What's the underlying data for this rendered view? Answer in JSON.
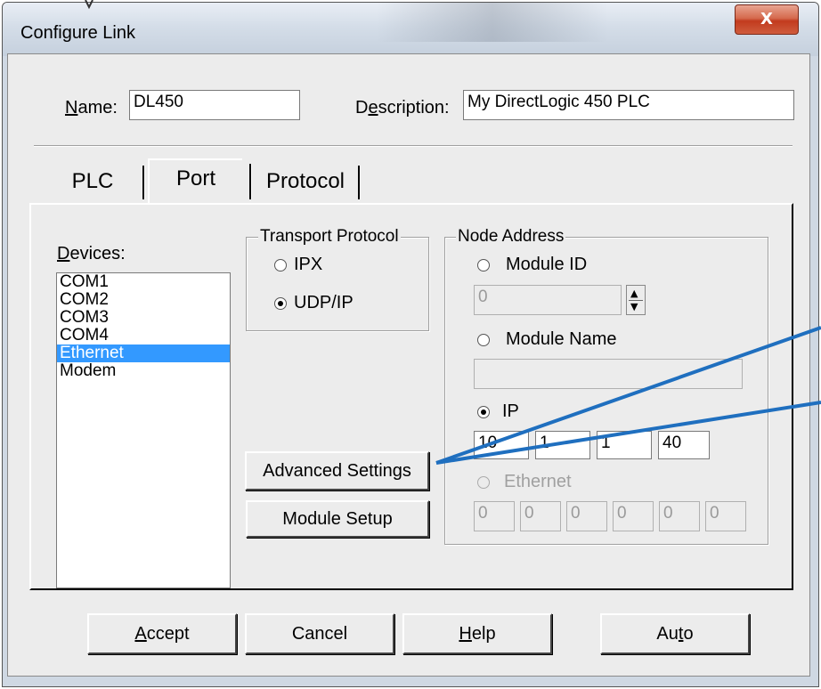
{
  "window": {
    "title": "Configure Link",
    "close_label": "X"
  },
  "name": {
    "label_u": "N",
    "label_rest": "ame:",
    "value": "DL450"
  },
  "description": {
    "label_a": "D",
    "label_u": "e",
    "label_rest": "scription:",
    "value": "My DirectLogic 450 PLC"
  },
  "tabs": [
    "PLC",
    "Port",
    "Protocol"
  ],
  "devices": {
    "label_u": "D",
    "label_rest": "evices:",
    "items": [
      "COM1",
      "COM2",
      "COM3",
      "COM4",
      "Ethernet",
      "Modem"
    ],
    "selected": "Ethernet"
  },
  "transport": {
    "title": "Transport Protocol",
    "options": [
      "IPX",
      "UDP/IP"
    ],
    "selected": "UDP/IP"
  },
  "node": {
    "title": "Node Address",
    "module_id_label": "Module ID",
    "module_id_value": "0",
    "module_name_label": "Module Name",
    "module_name_value": "",
    "ip_label": "IP",
    "ip": [
      "10",
      "1",
      "1",
      "40"
    ],
    "ethernet_label": "Ethernet",
    "ethernet": [
      "0",
      "0",
      "0",
      "0",
      "0",
      "0"
    ],
    "selected": "IP"
  },
  "buttons": {
    "advanced": "Advanced Settings",
    "module_setup": "Module Setup",
    "accept_u": "A",
    "accept_rest": "ccept",
    "cancel": "Cancel",
    "help_u": "H",
    "help_rest": "elp",
    "auto_a": "Au",
    "auto_u": "t",
    "auto_rest": "o"
  },
  "colors": {
    "selection": "#3399ff",
    "callout": "#1f6fbf",
    "close": "#c23b1e"
  }
}
